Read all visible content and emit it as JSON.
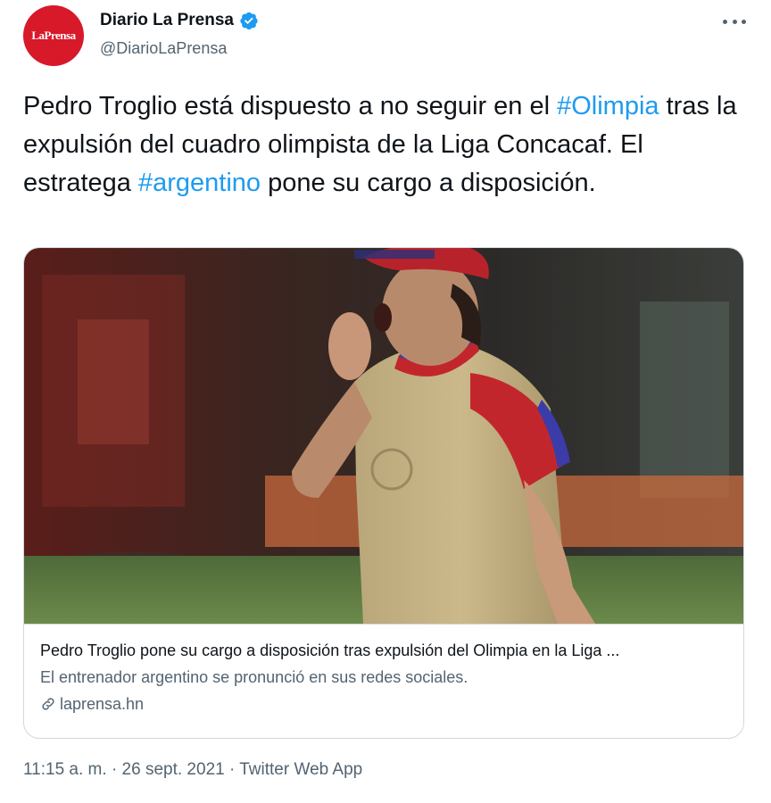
{
  "author": {
    "display_name": "Diario La Prensa",
    "handle": "@DiarioLaPrensa",
    "avatar_text": "LaPrensa",
    "verified_icon": "verified-badge-icon",
    "avatar_color": "#d7192a"
  },
  "tweet": {
    "text_1": "Pedro Troglio está dispuesto a no seguir en el ",
    "hashtag_1": "#Olimpia",
    "text_2": " tras la expulsión del cuadro olimpista de la Liga Concacaf. El estratega ",
    "hashtag_2": "#argentino",
    "text_3": " pone su cargo a disposición.",
    "hashtag_color": "#1d9bf0"
  },
  "card": {
    "title": "Pedro Troglio pone su cargo a disposición tras expulsión del Olimpia en la Liga ...",
    "description": "El entrenador argentino se pronunció en sus redes sociales.",
    "domain": "laprensa.hn",
    "link_icon": "link-icon"
  },
  "meta": {
    "time": "11:15 a. m.",
    "separator": "·",
    "date": "26 sept. 2021",
    "source": "Twitter Web App"
  },
  "more_icon": "more-options-icon"
}
